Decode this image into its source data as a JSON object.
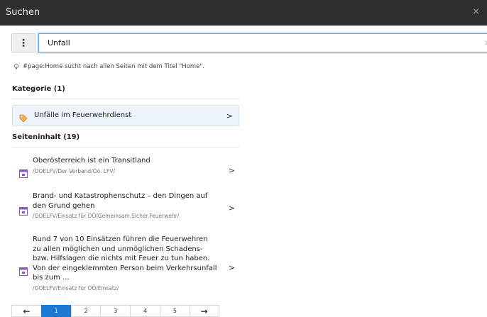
{
  "window": {
    "title": "Suchen",
    "close_glyph": "×"
  },
  "search": {
    "menu_glyph": "⋮",
    "value": "Unfall",
    "clear_glyph": "×"
  },
  "hint": {
    "icon": "lightbulb-icon",
    "text": "#page:Home sucht nach allen Seiten mit dem Titel \"Home\"."
  },
  "category_section": {
    "title": "Kategorie (1)",
    "items": [
      {
        "icon": "tag-icon",
        "label": "Unfälle im Feuerwehrdienst"
      }
    ]
  },
  "content_section": {
    "title": "Seiteninhalt (19)",
    "results": [
      {
        "icon": "page-icon",
        "title": "Oberösterreich ist ein Transitland",
        "path": "/OOELFV/Der Verband/Oö. LFV/"
      },
      {
        "icon": "page-icon",
        "title": "Brand- und Katastrophenschutz – den Dingen auf den Grund gehen",
        "path": "/OOELFV/Einsatz für OÖ/Gemeinsam.Sicher.Feuerwehr/"
      },
      {
        "icon": "page-icon",
        "title": "Rund 7 von 10 Einsätzen führen die Feuerwehren zu allen möglichen und unmöglichen Schadens- bzw. Hilfslagen die nichts mit Feuer zu tun haben. Von der eingeklemmten Person beim Verkehrsunfall bis zum ...",
        "path": "/OOELFV/Einsatz für OÖ/Einsatz/"
      }
    ]
  },
  "pagination": {
    "prev": "←",
    "pages": [
      "1",
      "2",
      "3",
      "4",
      "5"
    ],
    "current": "1",
    "next": "→"
  },
  "chevron_glyph": ">",
  "colors": {
    "titlebar": "#2f2f2f",
    "accent": "#1e78d0",
    "category_bg": "#eef4fb",
    "page_icon": "#8a5bbd"
  }
}
